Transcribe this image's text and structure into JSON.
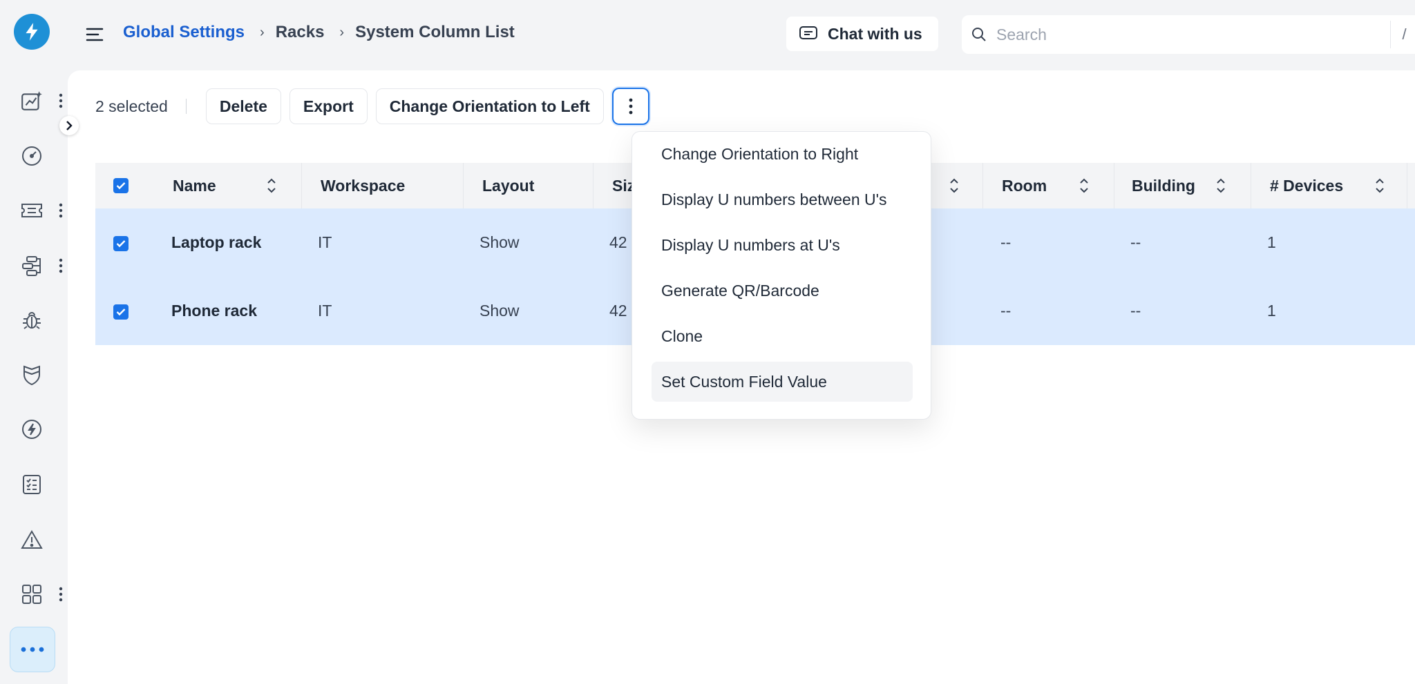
{
  "header": {
    "breadcrumb": [
      "Global Settings",
      "Racks",
      "System Column List"
    ],
    "chat_label": "Chat with us",
    "search_placeholder": "Search",
    "search_shortcut": "/"
  },
  "sidebar": {
    "items": [
      {
        "icon": "analytics-icon",
        "has_menu": true
      },
      {
        "icon": "gauge-icon",
        "has_menu": false
      },
      {
        "icon": "ticket-icon",
        "has_menu": true
      },
      {
        "icon": "workflow-icon",
        "has_menu": true
      },
      {
        "icon": "bug-icon",
        "has_menu": false
      },
      {
        "icon": "shield-icon",
        "has_menu": false
      },
      {
        "icon": "compass-icon",
        "has_menu": false
      },
      {
        "icon": "checklist-icon",
        "has_menu": false
      },
      {
        "icon": "warning-icon",
        "has_menu": false
      },
      {
        "icon": "apps-grid-icon",
        "has_menu": true
      }
    ],
    "more_icon": "more-horizontal-icon"
  },
  "toolbar": {
    "selected_text": "2 selected",
    "delete_label": "Delete",
    "export_label": "Export",
    "orientation_left_label": "Change Orientation to Left"
  },
  "table": {
    "columns": [
      "Name",
      "Workspace",
      "Layout",
      "Siz",
      "Room",
      "Building",
      "# Devices"
    ],
    "rows": [
      {
        "name": "Laptop rack",
        "workspace": "IT",
        "layout": "Show",
        "size": "42",
        "room": "--",
        "building": "--",
        "devices": "1",
        "selected": true
      },
      {
        "name": "Phone rack",
        "workspace": "IT",
        "layout": "Show",
        "size": "42",
        "room": "--",
        "building": "--",
        "devices": "1",
        "selected": true
      }
    ]
  },
  "dropdown": {
    "items": [
      "Change Orientation to Right",
      "Display U numbers between U's",
      "Display U numbers at U's",
      "Generate QR/Barcode",
      "Clone",
      "Set Custom Field Value"
    ],
    "hovered_index": 5
  },
  "colors": {
    "accent": "#1a73e8",
    "brand": "#1e90d6",
    "link": "#1a5fd0",
    "row_selected": "#dbeafe"
  }
}
